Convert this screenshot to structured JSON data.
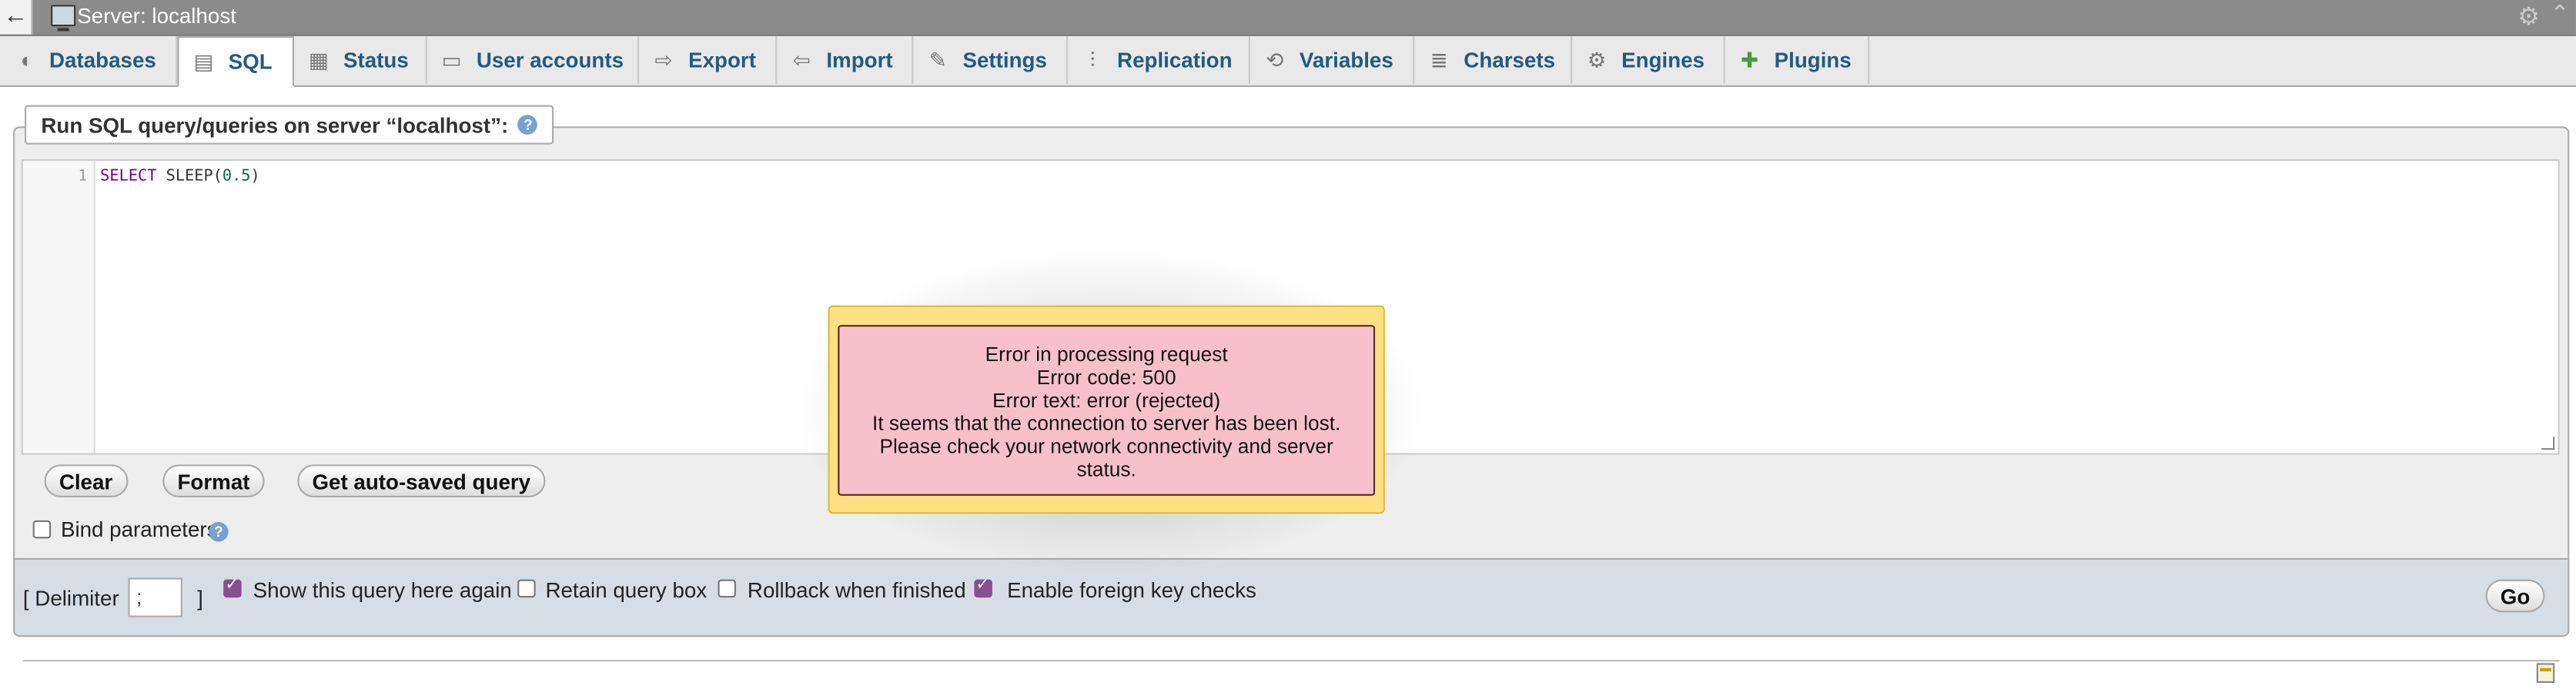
{
  "topbar": {
    "back": "←",
    "title": "Server: localhost",
    "gear": "⚙",
    "collapse": "⌃"
  },
  "tabs": [
    {
      "label": "Databases",
      "icon": "database-icon",
      "glyph": "◖"
    },
    {
      "label": "SQL",
      "icon": "sql-icon",
      "glyph": "▤"
    },
    {
      "label": "Status",
      "icon": "status-icon",
      "glyph": "▦"
    },
    {
      "label": "User accounts",
      "icon": "users-icon",
      "glyph": "▭"
    },
    {
      "label": "Export",
      "icon": "export-icon",
      "glyph": "⇨"
    },
    {
      "label": "Import",
      "icon": "import-icon",
      "glyph": "⇦"
    },
    {
      "label": "Settings",
      "icon": "wrench-icon",
      "glyph": "✎"
    },
    {
      "label": "Replication",
      "icon": "replication-icon",
      "glyph": "⫶"
    },
    {
      "label": "Variables",
      "icon": "variables-icon",
      "glyph": "⟲"
    },
    {
      "label": "Charsets",
      "icon": "charsets-icon",
      "glyph": "≣"
    },
    {
      "label": "Engines",
      "icon": "engines-icon",
      "glyph": "⚙"
    },
    {
      "label": "Plugins",
      "icon": "plugins-icon",
      "glyph": "✚"
    }
  ],
  "query": {
    "legend": "Run SQL query/queries on server “localhost”:",
    "help": "?",
    "line_number": "1",
    "code_keyword": "SELECT",
    "code_func": " SLEEP(",
    "code_num": "0.5",
    "code_end": ")"
  },
  "buttons": {
    "clear": "Clear",
    "format": "Format",
    "autosaved": "Get auto-saved query",
    "go": "Go"
  },
  "options": {
    "bind_parameters": "Bind parameters",
    "delimiter_open": "[ Delimiter",
    "delimiter_value": ";",
    "delimiter_close": "]",
    "show_query": "Show this query here again",
    "retain_box": "Retain query box",
    "rollback": "Rollback when finished",
    "foreign_keys": "Enable foreign key checks"
  },
  "error": {
    "line1": "Error in processing request",
    "line2": "Error code: 500",
    "line3": "Error text: error (rejected)",
    "line4": "It seems that the connection to server has been lost.",
    "line5": "Please check your network connectivity and server",
    "line6": "status."
  }
}
